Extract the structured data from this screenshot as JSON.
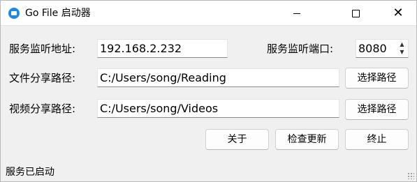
{
  "window": {
    "title": "Go File 启动器",
    "close_glyph": "✕"
  },
  "form": {
    "address_label": "服务监听地址:",
    "address_value": "192.168.2.232",
    "port_label": "服务监听端口:",
    "port_value": "8080",
    "file_share_label": "文件分享路径:",
    "file_share_value": "C:/Users/song/Reading",
    "video_share_label": "视频分享路径:",
    "video_share_value": "C:/Users/song/Videos",
    "choose_path_label": "选择路径"
  },
  "actions": {
    "about_label": "关于",
    "check_update_label": "检查更新",
    "stop_label": "终止"
  },
  "status": {
    "text": "服务已启动"
  },
  "icons": {
    "app": "folder-icon",
    "spin_up": "▲",
    "spin_down": "▼"
  },
  "colors": {
    "accent": "#1e88e5",
    "window_bg": "#f0f0f0",
    "titlebar_bg": "#ffffff"
  }
}
